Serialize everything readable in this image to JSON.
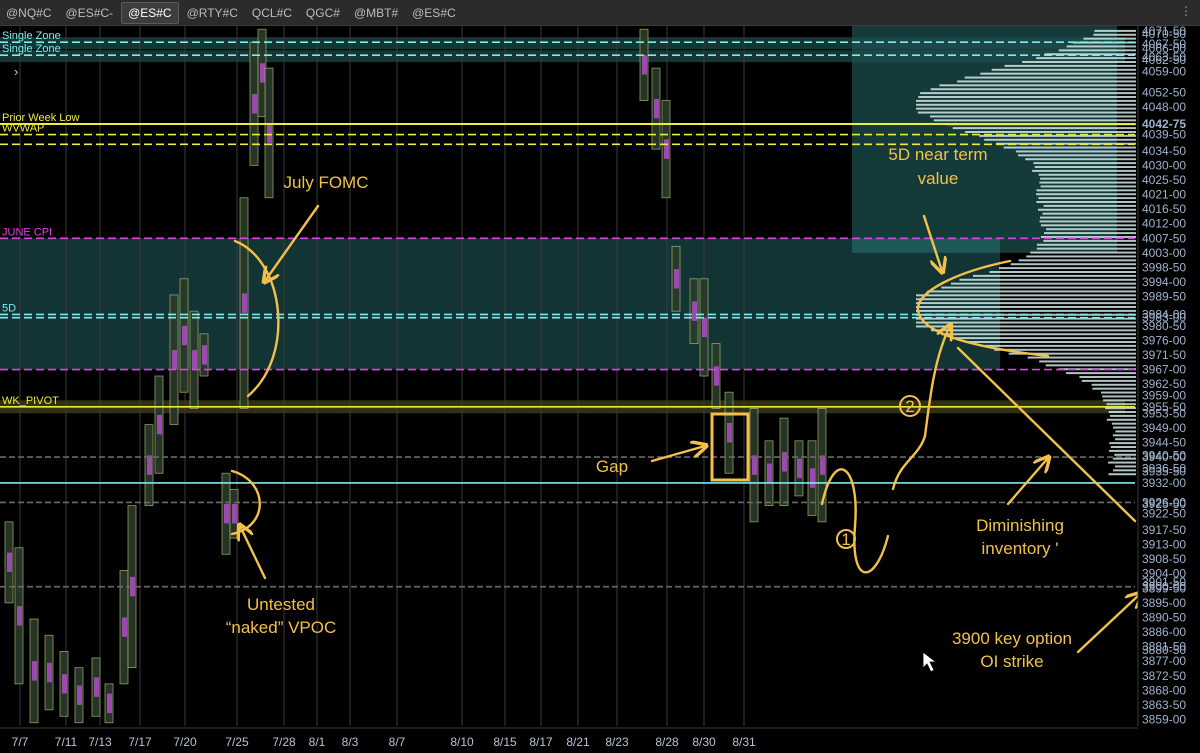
{
  "tabs": [
    {
      "label": "@NQ#C",
      "active": false
    },
    {
      "label": "@ES#C-",
      "active": false
    },
    {
      "label": "@ES#C",
      "active": true
    },
    {
      "label": "@RTY#C",
      "active": false
    },
    {
      "label": "QCL#C",
      "active": false
    },
    {
      "label": "QGC#",
      "active": false
    },
    {
      "label": "@MBT#",
      "active": false
    },
    {
      "label": "@ES#C",
      "active": false
    }
  ],
  "menu_glyph": "⋮",
  "colors": {
    "background": "#000000",
    "magenta": "#e040e6",
    "yellow": "#f0ea3c",
    "cyan": "#7feaf0",
    "annotation": "#f3c04a",
    "value_zone": "#2f8a88"
  },
  "chart_data": {
    "type": "market-profile",
    "x_dates": [
      "7/7",
      "7/11",
      "7/13",
      "7/17",
      "7/20",
      "7/25",
      "7/28",
      "8/1",
      "8/3",
      "8/7",
      "8/10",
      "8/15",
      "8/17",
      "8/21",
      "8/23",
      "8/28",
      "8/30",
      "8/31"
    ],
    "ylim": [
      3857,
      4073
    ],
    "price_ticks": [
      "4071-50",
      "4070-50",
      "4067-50",
      "4066-00",
      "4063-50",
      "4062-50",
      "4059-00",
      "4052-50",
      "4048-00",
      "4042-75",
      "4039-50",
      "4034-50",
      "4030-00",
      "4025-50",
      "4021-00",
      "4016-50",
      "4012-00",
      "4007-50",
      "4003-00",
      "3998-50",
      "3994-00",
      "3989-50",
      "3984-00",
      "3983-00",
      "3980-50",
      "3976-00",
      "3971-50",
      "3967-00",
      "3962-50",
      "3959-00",
      "3955-50",
      "3953-50",
      "3949-00",
      "3944-50",
      "3940-00",
      "3940-50",
      "3936-50",
      "3935-50",
      "3932-00",
      "3926-00",
      "3925-50",
      "3922-50",
      "3917-50",
      "3913-00",
      "3908-50",
      "3904-00",
      "3901-50",
      "3900-00",
      "3899-50",
      "3895-00",
      "3890-50",
      "3886-00",
      "3881-50",
      "3880-50",
      "3877-00",
      "3872-50",
      "3868-00",
      "3863-50",
      "3859-00"
    ],
    "highlighted_ticks": [
      "4042-75"
    ],
    "levels": [
      {
        "label": "Single Zone",
        "price": 4068,
        "color": "cyan"
      },
      {
        "label": "Single Zone",
        "price": 4064,
        "color": "cyan"
      },
      {
        "label": "Prior Week Low",
        "price": 4042.75,
        "color": "yellow"
      },
      {
        "label": "WVWAP",
        "price": 4039.5,
        "color": "yellow"
      },
      {
        "label": "JUNE CPI",
        "price": 4007.5,
        "color": "magenta"
      },
      {
        "label": "5D",
        "price": 3984,
        "color": "cyan"
      },
      {
        "label": "WK_PIVOT",
        "price": 3955.5,
        "color": "yellow"
      }
    ],
    "extra_levels": [
      {
        "price": 4036.5,
        "color": "yellow"
      },
      {
        "price": 3983,
        "color": "cyan"
      },
      {
        "price": 3967,
        "color": "magenta"
      },
      {
        "price": 3932,
        "color": "cyan"
      },
      {
        "price": 3940,
        "color": "gray"
      },
      {
        "price": 3926,
        "color": "gray"
      },
      {
        "price": 3900,
        "color": "gray"
      }
    ],
    "annotations": [
      {
        "text": "July FOMC",
        "lines": [
          "July FOMC"
        ]
      },
      {
        "text": "5D near term value",
        "lines": [
          "5D near term",
          "value"
        ]
      },
      {
        "text": "Gap",
        "lines": [
          "Gap"
        ]
      },
      {
        "text": "Diminishing inventory '",
        "lines": [
          "Diminishing",
          "inventory '"
        ]
      },
      {
        "text": "Untested “naked” VPOC",
        "lines": [
          "Untested",
          "“naked” VPOC"
        ]
      },
      {
        "text": "3900 key option OI strike",
        "lines": [
          "3900 key option",
          "OI strike"
        ]
      },
      {
        "text": "1",
        "lines": [
          "1"
        ]
      },
      {
        "text": "2",
        "lines": [
          "2"
        ]
      }
    ]
  }
}
